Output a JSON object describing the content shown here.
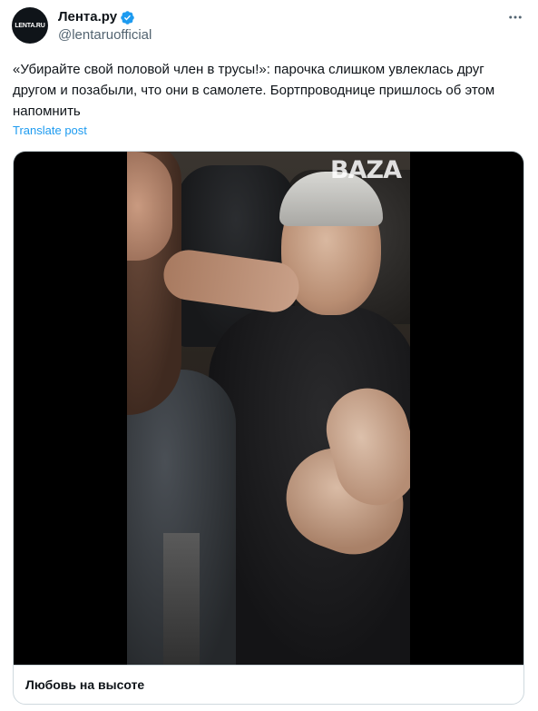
{
  "author": {
    "display_name": "Лента.ру",
    "handle": "@lentaruofficial",
    "avatar_text": "LENTA.RU",
    "verified_icon": "verified-badge-icon",
    "verified_color": "#1d9bf0"
  },
  "tweet": {
    "text": "«Убирайте свой половой член в трусы!»: парочка слишком увлеклась друг другом и позабыли, что они в самолете. Бортпроводнице пришлось об этом напомнить",
    "translate_label": "Translate post",
    "more_icon": "more-options-icon"
  },
  "media": {
    "watermark": "BAZA",
    "caption": "Любовь на высоте"
  },
  "colors": {
    "text_primary": "#0f1419",
    "text_secondary": "#536471",
    "link": "#1d9bf0",
    "border": "#cfd9de"
  }
}
